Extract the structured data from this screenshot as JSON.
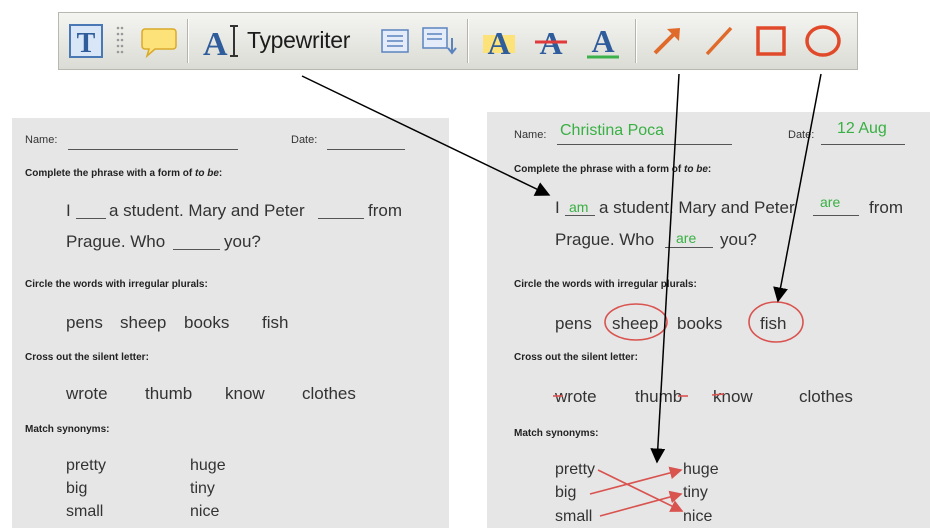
{
  "toolbar": {
    "typewriter_label": "Typewriter",
    "icons": [
      "text-box-icon",
      "drag-handle-icon",
      "callout-icon",
      "typewriter-icon",
      "textbox-set-icon",
      "textbox-move-icon",
      "text-highlight-icon",
      "text-strikeout-icon",
      "text-underline-icon",
      "arrow-icon",
      "line-icon",
      "rectangle-icon",
      "oval-icon"
    ]
  },
  "worksheet": {
    "name_label": "Name:",
    "date_label": "Date:",
    "section1_title_a": "Complete the phrase with a form of ",
    "section1_title_em": "to be",
    "section1_title_b": ":",
    "s1_w1": "I",
    "s1_w2": "a student. Mary and Peter",
    "s1_w3": "from",
    "s1_w4": "Prague. Who",
    "s1_w5": "you?",
    "section2_title": "Circle the words with irregular plurals:",
    "plurals": [
      "pens",
      "sheep",
      "books",
      "fish"
    ],
    "section3_title": "Cross out the silent letter:",
    "silent": [
      "wrote",
      "thumb",
      "know",
      "clothes"
    ],
    "section4_title": "Match synonyms:",
    "syn_left": [
      "pretty",
      "big",
      "small"
    ],
    "syn_right": [
      "huge",
      "tiny",
      "nice"
    ]
  },
  "filled": {
    "name": "Christina Poca",
    "date": "12 Aug",
    "answer1": "am",
    "answer2": "are",
    "answer3": "are"
  },
  "colors": {
    "fill_text": "#3fb24a",
    "markup": "#d9534f",
    "sheet_bg": "#e6e6e6"
  }
}
